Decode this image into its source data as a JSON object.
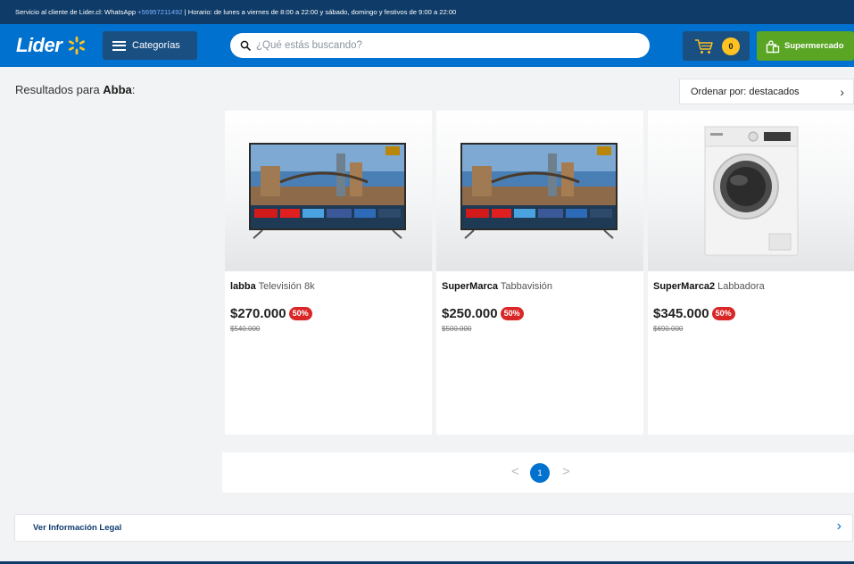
{
  "topbar": {
    "text_before": "Servicio al cliente de Lider.cl: WhatsApp ",
    "phone": "+56957211492",
    "text_after": " | Horario: de lunes a viernes de 8:00 a 22:00 y sábado, domingo y festivos de 9:00 a 22:00"
  },
  "header": {
    "logo_text": "Lider",
    "categories_label": "Categorías",
    "search_placeholder": "¿Qué estás buscando?",
    "cart_count": "0",
    "supermarket_label": "Supermercado"
  },
  "results": {
    "prefix": "Resultados para ",
    "query": "Abba",
    "suffix": ":",
    "sort_label": "Ordenar por: destacados"
  },
  "products": [
    {
      "brand": "labba",
      "name": "Televisión 8k",
      "price": "$270.000",
      "discount": "50%",
      "old_price": "$540.000",
      "image": "tv-image"
    },
    {
      "brand": "SuperMarca",
      "name": "Tabbavisión",
      "price": "$250.000",
      "discount": "50%",
      "old_price": "$500.000",
      "image": "tv-image"
    },
    {
      "brand": "SuperMarca2",
      "name": "Labbadora",
      "price": "$345.000",
      "discount": "50%",
      "old_price": "$690.000",
      "image": "washing-machine-image"
    }
  ],
  "pagination": {
    "current_page": "1",
    "prev_icon": "chevron-left-icon",
    "next_icon": "chevron-right-icon"
  },
  "legal": {
    "label": "Ver Información Legal"
  },
  "colors": {
    "brand_blue": "#0071ce",
    "dark_blue": "#0f3b68",
    "spark_yellow": "#ffc220",
    "supermarket_green": "#5aa624",
    "discount_red": "#d92626"
  }
}
